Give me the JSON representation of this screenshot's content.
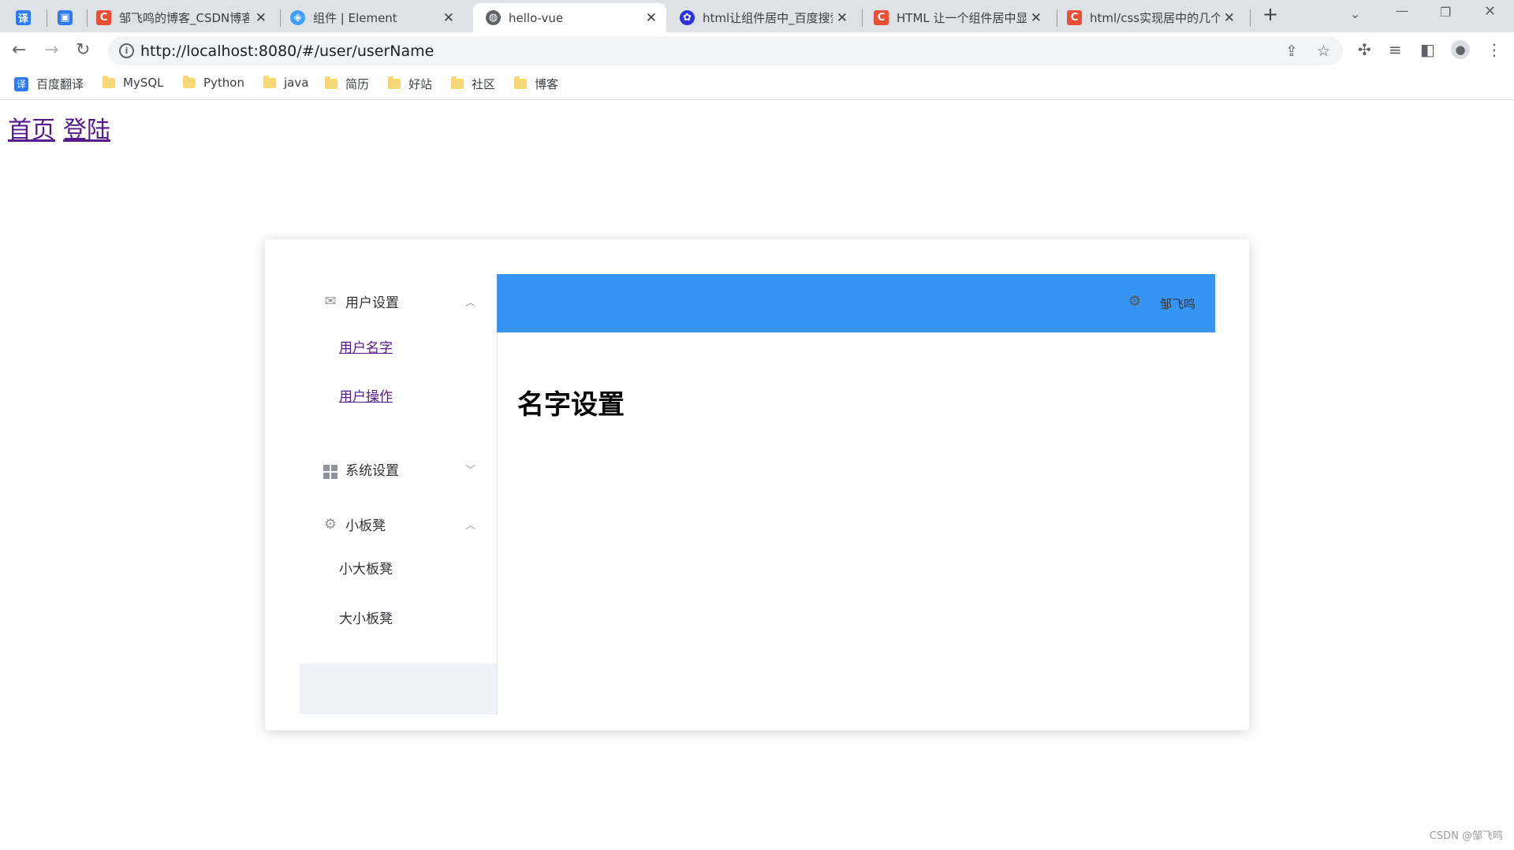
{
  "browser": {
    "tabs": [
      {
        "title": "",
        "favicon": "译",
        "favicon_color": "#2b7bf6"
      },
      {
        "title": "",
        "favicon": "bilibili-icon",
        "favicon_color": "#2b7bf6"
      },
      {
        "title": "邹飞鸣的博客_CSDN博客",
        "favicon": "C",
        "favicon_color": "#e94f35"
      },
      {
        "title": "组件 | Element",
        "favicon": "element-icon",
        "favicon_color": "#409eff"
      },
      {
        "title": "hello-vue",
        "favicon": "globe-icon",
        "favicon_color": "#5f6368"
      },
      {
        "title": "html让组件居中_百度搜索",
        "favicon": "baidu-icon",
        "favicon_color": "#2932e1"
      },
      {
        "title": "HTML 让一个组件居中显示",
        "favicon": "C",
        "favicon_color": "#e94f35"
      },
      {
        "title": "html/css实现居中的几个",
        "favicon": "C",
        "favicon_color": "#e94f35"
      }
    ],
    "url": "http://localhost:8080/#/user/userName",
    "bookmarks": [
      {
        "label": "百度翻译",
        "icon": "translate-icon"
      },
      {
        "label": "MySQL",
        "icon": "folder-icon"
      },
      {
        "label": "Python",
        "icon": "folder-icon"
      },
      {
        "label": "java",
        "icon": "folder-icon"
      },
      {
        "label": "简历",
        "icon": "folder-icon"
      },
      {
        "label": "好站",
        "icon": "folder-icon"
      },
      {
        "label": "社区",
        "icon": "folder-icon"
      },
      {
        "label": "博客",
        "icon": "folder-icon"
      }
    ]
  },
  "page": {
    "links": [
      "首页",
      "登陆"
    ]
  },
  "sidebar": {
    "groups": [
      {
        "label": "用户设置",
        "icon": "message-icon",
        "expanded": true,
        "items": [
          {
            "label": "用户名字"
          },
          {
            "label": "用户操作"
          }
        ]
      },
      {
        "label": "系统设置",
        "icon": "menu-grid-icon",
        "expanded": false,
        "items": []
      },
      {
        "label": "小板凳",
        "icon": "gear-icon",
        "expanded": true,
        "items": [
          {
            "label": "小大板凳"
          },
          {
            "label": "大小板凳"
          }
        ]
      }
    ]
  },
  "header": {
    "username": "邹飞鸣",
    "background": "#3894f2"
  },
  "main": {
    "title": "名字设置"
  },
  "watermark": "CSDN @邹飞鸣"
}
